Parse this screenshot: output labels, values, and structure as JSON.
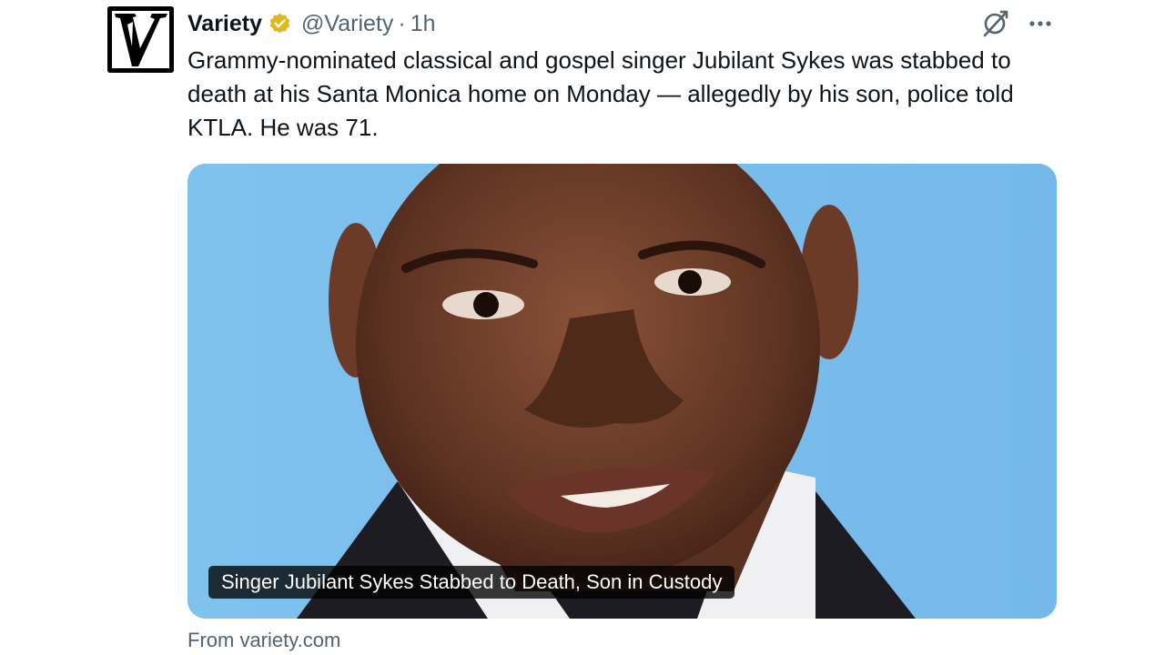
{
  "author": {
    "display_name": "Variety",
    "handle": "@Variety",
    "separator": "·",
    "time": "1h",
    "verified_color": "#e2b719"
  },
  "tweet": {
    "text": "Grammy-nominated classical and gospel singer Jubilant Sykes was stabbed to death at his Santa Monica home on Monday — allegedly by his son, police told KTLA. He was 71."
  },
  "card": {
    "caption": "Singer Jubilant Sykes Stabbed to Death, Son in Custody",
    "background_color": "#7ec0ee"
  },
  "source": {
    "label": "From variety.com"
  },
  "icons": {
    "avatar": "variety-logo-icon",
    "verified": "verified-badge-icon",
    "grok": "grok-icon",
    "more": "more-options-icon"
  }
}
